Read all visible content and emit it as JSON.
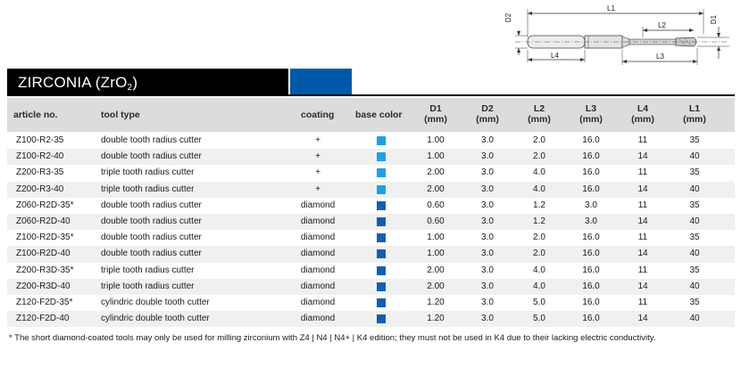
{
  "drawing": {
    "labels": {
      "l1": "L1",
      "l2": "L2",
      "l3": "L3",
      "l4": "L4",
      "d1": "D1",
      "d2": "D2"
    }
  },
  "title": {
    "main": "ZIRCONIA (ZrO",
    "sub": "2",
    "close": ")"
  },
  "colors": {
    "title_bg": "#000000",
    "title_accent": "#0059a8",
    "light_blue": "#1ea0e6",
    "dark_blue": "#1060b0",
    "header_bg": "#dcdcdc"
  },
  "table": {
    "headers": {
      "article": "article no.",
      "tool": "tool type",
      "coating": "coating",
      "base": "base color",
      "d1": "D1",
      "d2": "D2",
      "l2": "L2",
      "l3": "L3",
      "l4": "L4",
      "l1": "L1",
      "unit": "(mm)"
    },
    "rows": [
      {
        "article": "Z100-R2-35",
        "tool": "double tooth radius cutter",
        "coating": "+",
        "color": "light",
        "d1": "1.00",
        "d2": "3.0",
        "l2": "2.0",
        "l3": "16.0",
        "l4": "11",
        "l1": "35"
      },
      {
        "article": "Z100-R2-40",
        "tool": "double tooth radius cutter",
        "coating": "+",
        "color": "light",
        "d1": "1.00",
        "d2": "3.0",
        "l2": "2.0",
        "l3": "16.0",
        "l4": "14",
        "l1": "40"
      },
      {
        "article": "Z200-R3-35",
        "tool": "triple tooth radius cutter",
        "coating": "+",
        "color": "light",
        "d1": "2.00",
        "d2": "3.0",
        "l2": "4.0",
        "l3": "16.0",
        "l4": "11",
        "l1": "35"
      },
      {
        "article": "Z200-R3-40",
        "tool": "triple tooth radius cutter",
        "coating": "+",
        "color": "light",
        "d1": "2.00",
        "d2": "3.0",
        "l2": "4.0",
        "l3": "16.0",
        "l4": "14",
        "l1": "40"
      },
      {
        "article": "Z060-R2D-35*",
        "tool": "double tooth radius cutter",
        "coating": "diamond",
        "color": "dark",
        "d1": "0.60",
        "d2": "3.0",
        "l2": "1.2",
        "l3": "3.0",
        "l4": "11",
        "l1": "35"
      },
      {
        "article": "Z060-R2D-40",
        "tool": "double tooth radius cutter",
        "coating": "diamond",
        "color": "dark",
        "d1": "0.60",
        "d2": "3.0",
        "l2": "1.2",
        "l3": "3.0",
        "l4": "14",
        "l1": "40"
      },
      {
        "article": "Z100-R2D-35*",
        "tool": "double tooth radius cutter",
        "coating": "diamond",
        "color": "dark",
        "d1": "1.00",
        "d2": "3.0",
        "l2": "2.0",
        "l3": "16.0",
        "l4": "11",
        "l1": "35"
      },
      {
        "article": "Z100-R2D-40",
        "tool": "double tooth radius cutter",
        "coating": "diamond",
        "color": "dark",
        "d1": "1.00",
        "d2": "3.0",
        "l2": "2.0",
        "l3": "16.0",
        "l4": "14",
        "l1": "40"
      },
      {
        "article": "Z200-R3D-35*",
        "tool": "triple tooth radius cutter",
        "coating": "diamond",
        "color": "dark",
        "d1": "2.00",
        "d2": "3.0",
        "l2": "4.0",
        "l3": "16.0",
        "l4": "11",
        "l1": "35"
      },
      {
        "article": "Z200-R3D-40",
        "tool": "triple tooth radius cutter",
        "coating": "diamond",
        "color": "dark",
        "d1": "2.00",
        "d2": "3.0",
        "l2": "4.0",
        "l3": "16.0",
        "l4": "14",
        "l1": "40"
      },
      {
        "article": "Z120-F2D-35*",
        "tool": "cylindric double tooth cutter",
        "coating": "diamond",
        "color": "dark",
        "d1": "1.20",
        "d2": "3.0",
        "l2": "5.0",
        "l3": "16.0",
        "l4": "11",
        "l1": "35"
      },
      {
        "article": "Z120-F2D-40",
        "tool": "cylindric double tooth cutter",
        "coating": "diamond",
        "color": "dark",
        "d1": "1.20",
        "d2": "3.0",
        "l2": "5.0",
        "l3": "16.0",
        "l4": "14",
        "l1": "40"
      }
    ]
  },
  "footnote": "* The short diamond-coated tools may only be used for milling zirconium with Z4 | N4 | N4+ | K4 edition; they must not be used in K4 due to their lacking electric conductivity."
}
